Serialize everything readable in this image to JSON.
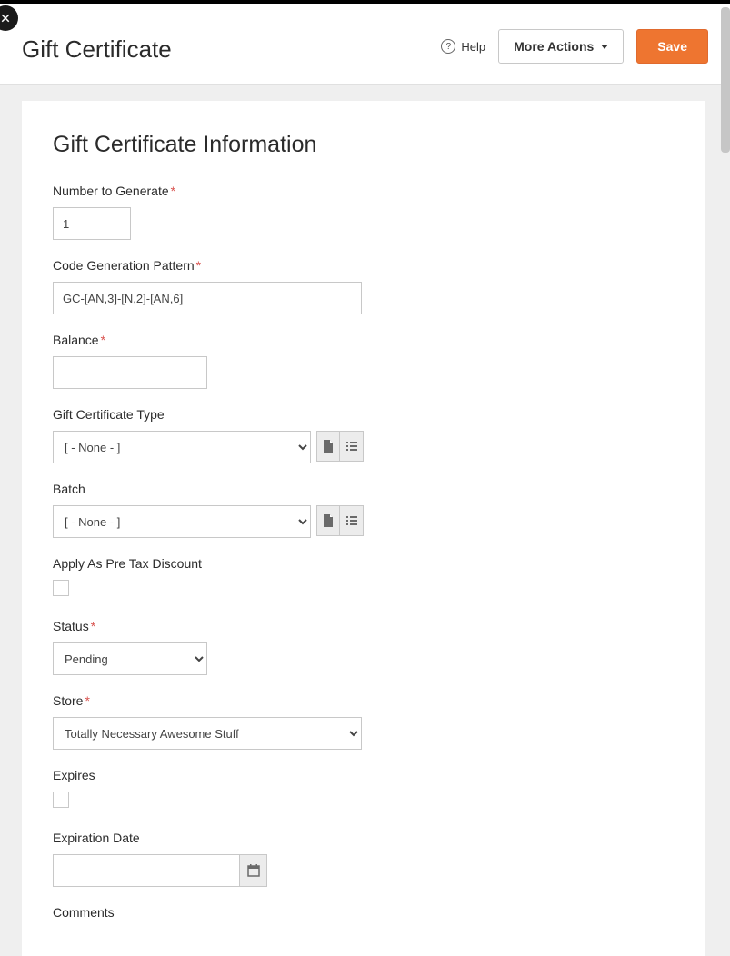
{
  "header": {
    "title": "Gift Certificate",
    "help": "Help",
    "more_actions": "More Actions",
    "save": "Save"
  },
  "section_title": "Gift Certificate Information",
  "fields": {
    "number_to_generate": {
      "label": "Number to Generate",
      "value": "1"
    },
    "code_pattern": {
      "label": "Code Generation Pattern",
      "value": "GC-[AN,3]-[N,2]-[AN,6]"
    },
    "balance": {
      "label": "Balance",
      "value": ""
    },
    "type": {
      "label": "Gift Certificate Type",
      "selected": "[ - None - ]"
    },
    "batch": {
      "label": "Batch",
      "selected": "[ - None - ]"
    },
    "apply_pretax": {
      "label": "Apply As Pre Tax Discount",
      "checked": false
    },
    "status": {
      "label": "Status",
      "selected": "Pending"
    },
    "store": {
      "label": "Store",
      "selected": "Totally Necessary Awesome Stuff"
    },
    "expires": {
      "label": "Expires",
      "checked": false
    },
    "expiration_date": {
      "label": "Expiration Date",
      "value": ""
    },
    "comments": {
      "label": "Comments"
    }
  }
}
